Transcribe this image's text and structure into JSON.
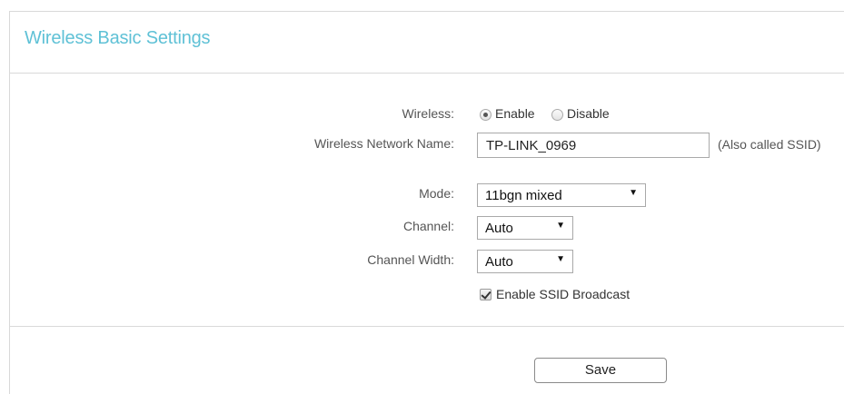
{
  "page": {
    "title": "Wireless Basic Settings"
  },
  "wireless": {
    "label": "Wireless:",
    "options": [
      "Enable",
      "Disable"
    ],
    "selected": "Enable"
  },
  "network_name": {
    "label": "Wireless Network Name:",
    "value": "TP-LINK_0969",
    "hint": "(Also called SSID)"
  },
  "mode": {
    "label": "Mode:",
    "value": "11bgn mixed"
  },
  "channel": {
    "label": "Channel:",
    "value": "Auto"
  },
  "channel_width": {
    "label": "Channel Width:",
    "value": "Auto"
  },
  "ssid_broadcast": {
    "label": "Enable SSID Broadcast",
    "checked": true
  },
  "actions": {
    "save_label": "Save"
  },
  "colors": {
    "title": "#5fc1d6",
    "divider": "#d9d9d9"
  }
}
